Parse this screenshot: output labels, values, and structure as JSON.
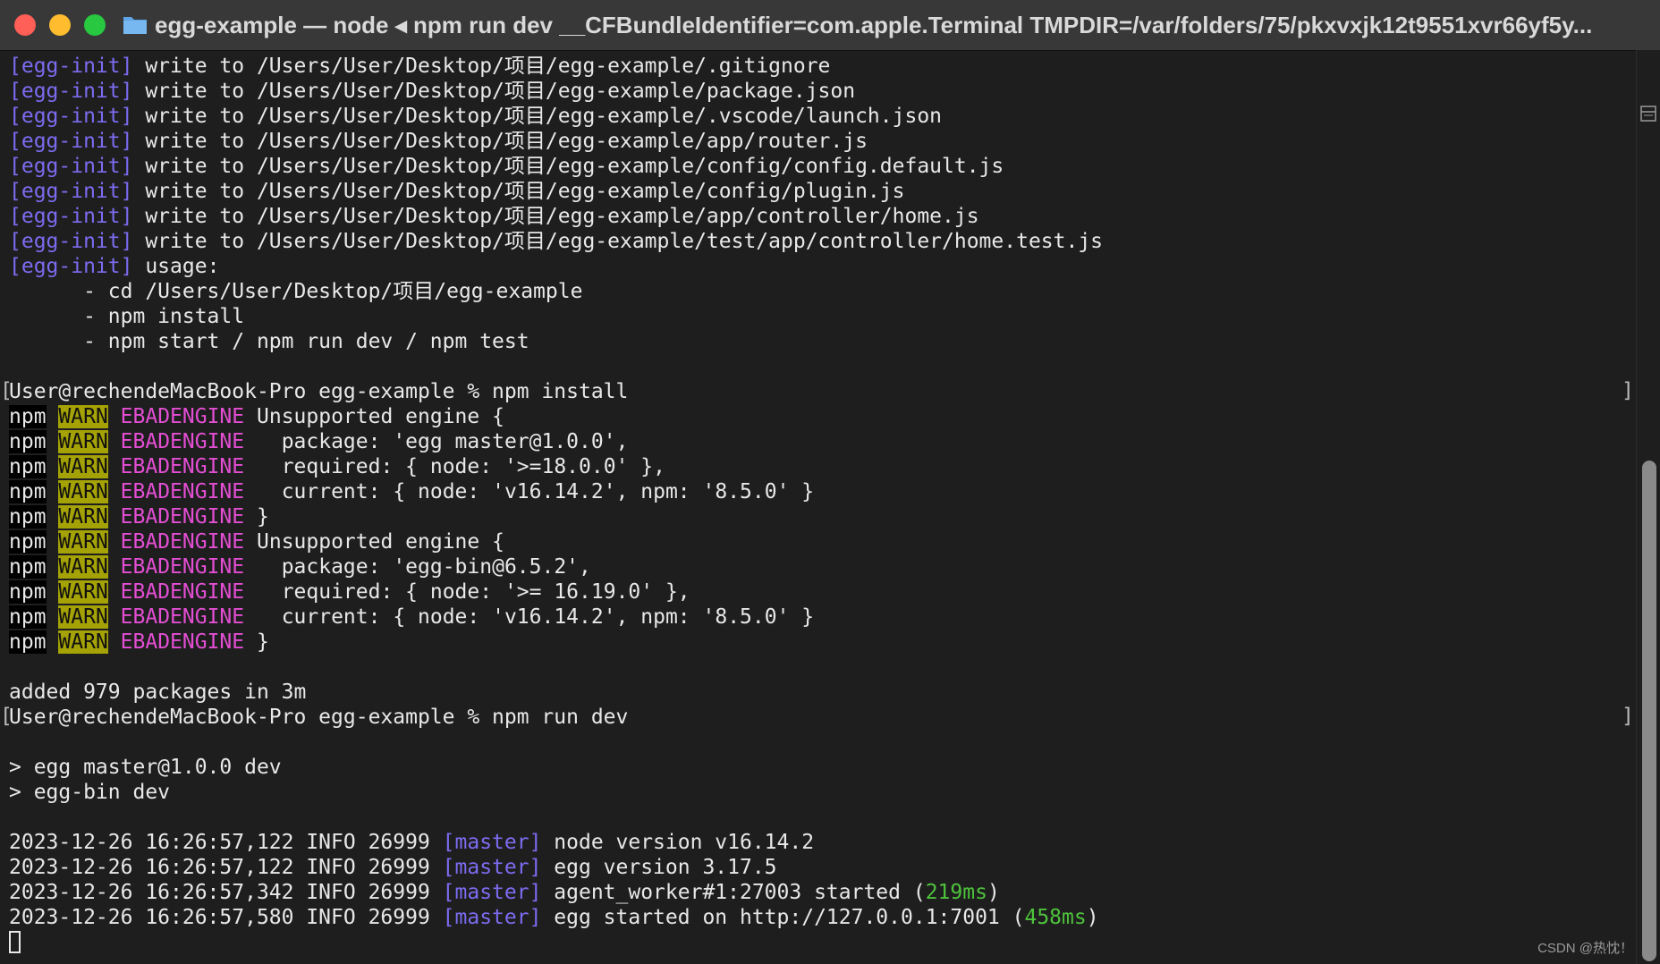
{
  "window": {
    "title": "egg-example — node ◂ npm run dev __CFBundleIdentifier=com.apple.Terminal TMPDIR=/var/folders/75/pkxvxjk12t9551xvr66yf5y..."
  },
  "terminal": {
    "init_lines": [
      {
        "tag": "[egg-init]",
        "text": " write to /Users/User/Desktop/项目/egg-example/.gitignore"
      },
      {
        "tag": "[egg-init]",
        "text": " write to /Users/User/Desktop/项目/egg-example/package.json"
      },
      {
        "tag": "[egg-init]",
        "text": " write to /Users/User/Desktop/项目/egg-example/.vscode/launch.json"
      },
      {
        "tag": "[egg-init]",
        "text": " write to /Users/User/Desktop/项目/egg-example/app/router.js"
      },
      {
        "tag": "[egg-init]",
        "text": " write to /Users/User/Desktop/项目/egg-example/config/config.default.js"
      },
      {
        "tag": "[egg-init]",
        "text": " write to /Users/User/Desktop/项目/egg-example/config/plugin.js"
      },
      {
        "tag": "[egg-init]",
        "text": " write to /Users/User/Desktop/项目/egg-example/app/controller/home.js"
      },
      {
        "tag": "[egg-init]",
        "text": " write to /Users/User/Desktop/项目/egg-example/test/app/controller/home.test.js"
      },
      {
        "tag": "[egg-init]",
        "text": " usage:"
      }
    ],
    "usage_lines": [
      "      - cd /Users/User/Desktop/项目/egg-example",
      "      - npm install",
      "      - npm start / npm run dev / npm test"
    ],
    "prompt1": "User@rechendeMacBook-Pro egg-example % npm install",
    "warn_lines": [
      "Unsupported engine {",
      "  package: 'egg master@1.0.0',",
      "  required: { node: '>=18.0.0' },",
      "  current: { node: 'v16.14.2', npm: '8.5.0' }",
      "}",
      "Unsupported engine {",
      "  package: 'egg-bin@6.5.2',",
      "  required: { node: '>= 16.19.0' },",
      "  current: { node: 'v16.14.2', npm: '8.5.0' }",
      "}"
    ],
    "npm_label": "npm",
    "warn_label": "WARN",
    "ebadengine_label": "EBADENGINE",
    "added_line": "added 979 packages in 3m",
    "prompt2": "User@rechendeMacBook-Pro egg-example % npm run dev",
    "dev_lines": [
      "> egg master@1.0.0 dev",
      "> egg-bin dev"
    ],
    "log_lines": [
      {
        "prefix": "2023-12-26 16:26:57,122 INFO 26999 ",
        "tag": "[master]",
        "text": " node version v16.14.2",
        "ms": "",
        "suffix": ""
      },
      {
        "prefix": "2023-12-26 16:26:57,122 INFO 26999 ",
        "tag": "[master]",
        "text": " egg version 3.17.5",
        "ms": "",
        "suffix": ""
      },
      {
        "prefix": "2023-12-26 16:26:57,342 INFO 26999 ",
        "tag": "[master]",
        "text": " agent_worker#1:27003 started (",
        "ms": "219ms",
        "suffix": ")"
      },
      {
        "prefix": "2023-12-26 16:26:57,580 INFO 26999 ",
        "tag": "[master]",
        "text": " egg started on http://127.0.0.1:7001 (",
        "ms": "458ms",
        "suffix": ")"
      }
    ]
  },
  "watermark": "CSDN @热忱！"
}
